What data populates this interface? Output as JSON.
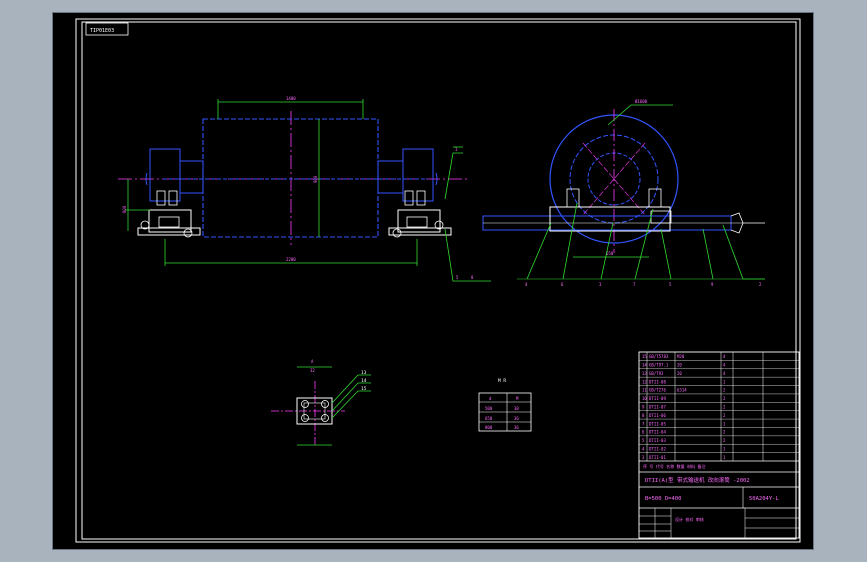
{
  "drawing": {
    "tag": "TIP01E03",
    "colors": {
      "background": "#000000",
      "frame": "#ffffff",
      "outline_blue": "#3355ff",
      "centerline_magenta": "#ff3cff",
      "dimension_green": "#2fdc2f",
      "body_white": "#ffffff",
      "text_magenta": "#ff6bff"
    },
    "views": {
      "front": {
        "top_dim": "1400",
        "bottom_dim": "2200",
        "left_dim": "800",
        "right_dim": "900",
        "callouts": [
          "1",
          "5",
          "8"
        ]
      },
      "side": {
        "top_note": "Ø1600",
        "bottom_dim": "650",
        "callouts": [
          "4",
          "6",
          "3",
          "7",
          "5",
          "9",
          "2"
        ]
      },
      "detail": {
        "top_label": "A",
        "top_sub": "32",
        "callouts": [
          "13",
          "14",
          "15"
        ]
      }
    },
    "small_table": {
      "title": "M R",
      "header": [
        "d",
        "M"
      ],
      "rows": [
        [
          "500",
          "30"
        ],
        [
          "650",
          "36"
        ],
        [
          "800",
          "36"
        ]
      ]
    },
    "title_block": {
      "parts_rows": [
        [
          "15",
          "GB/T5783",
          "M20",
          "4",
          "",
          ""
        ],
        [
          "14",
          "GB/T97.1",
          "20",
          "4",
          "",
          ""
        ],
        [
          "13",
          "GB/T93",
          "20",
          "4",
          "",
          ""
        ],
        [
          "12",
          "DTII-08",
          "",
          "1",
          "",
          ""
        ],
        [
          "11",
          "GB/T276",
          "6314",
          "2",
          "",
          ""
        ],
        [
          "10",
          "DTII-09",
          "",
          "2",
          "",
          ""
        ],
        [
          "9",
          "DTII-07",
          "",
          "2",
          "",
          ""
        ],
        [
          "8",
          "DTII-06",
          "",
          "2",
          "",
          ""
        ],
        [
          "7",
          "DTII-05",
          "",
          "1",
          "",
          ""
        ],
        [
          "6",
          "DTII-04",
          "",
          "2",
          "",
          ""
        ],
        [
          "5",
          "DTII-03",
          "",
          "2",
          "",
          ""
        ],
        [
          "4",
          "DTII-02",
          "",
          "1",
          "",
          ""
        ],
        [
          "3",
          "DTII-01",
          "",
          "1",
          "",
          ""
        ]
      ],
      "legend_row": "序 号   代号   名称   数量   材料   备注",
      "main_title": "DTII(A)型 带式输送机 改向滚筒 -2002",
      "spec_1": "B=500 D=400",
      "spec_2": "50A204Y-L",
      "sign_label": "设计 校对 审核"
    }
  }
}
